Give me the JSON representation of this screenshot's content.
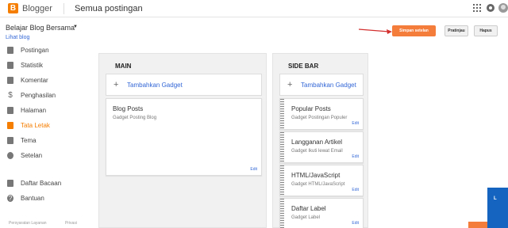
{
  "topbar": {
    "logo_letter": "B",
    "brand": "Blogger",
    "page_title": "Semua postingan"
  },
  "blog": {
    "name": "Belajar Blog Bersama",
    "view_link": "Lihat blog"
  },
  "sidebar": {
    "items": [
      {
        "label": "Postingan",
        "icon": "posts-icon"
      },
      {
        "label": "Statistik",
        "icon": "stats-icon"
      },
      {
        "label": "Komentar",
        "icon": "comment-icon"
      },
      {
        "label": "Penghasilan",
        "icon": "dollar-icon"
      },
      {
        "label": "Halaman",
        "icon": "pages-icon"
      },
      {
        "label": "Tata Letak",
        "icon": "layout-icon",
        "active": true
      },
      {
        "label": "Tema",
        "icon": "paint-roller-icon"
      },
      {
        "label": "Setelan",
        "icon": "gear-icon"
      },
      {
        "label": "Daftar Bacaan",
        "icon": "reading-list-icon"
      },
      {
        "label": "Bantuan",
        "icon": "help-icon"
      }
    ],
    "footer": [
      "Persyaratan Layanan",
      "Privasi"
    ]
  },
  "actions": {
    "save": "Simpan setelan",
    "preview": "Pratinjau",
    "reset": "Hapus"
  },
  "main_column": {
    "title": "MAIN",
    "add_gadget": "Tambahkan Gadget",
    "gadgets": [
      {
        "title": "Blog Posts",
        "subtitle": "Gadget Posting Blog",
        "edit": "Edit"
      }
    ]
  },
  "side_column": {
    "title": "SIDE BAR",
    "add_gadget": "Tambahkan Gadget",
    "gadgets": [
      {
        "title": "Popular Posts",
        "subtitle": "Gadget Postingan Populer",
        "edit": "Edit"
      },
      {
        "title": "Langganan Artikel",
        "subtitle": "Gadget Ikuti lewat Email",
        "edit": "Edit"
      },
      {
        "title": "HTML/JavaScript",
        "subtitle": "Gadget HTML/JavaScript",
        "edit": "Edit"
      },
      {
        "title": "Daftar Label",
        "subtitle": "Gadget Label",
        "edit": "Edit"
      }
    ]
  },
  "right_panel": {
    "letter": "L"
  },
  "colors": {
    "accent": "#f57d00",
    "save_button": "#f57d3c",
    "link": "#3367d6",
    "panel": "#1565c0"
  }
}
